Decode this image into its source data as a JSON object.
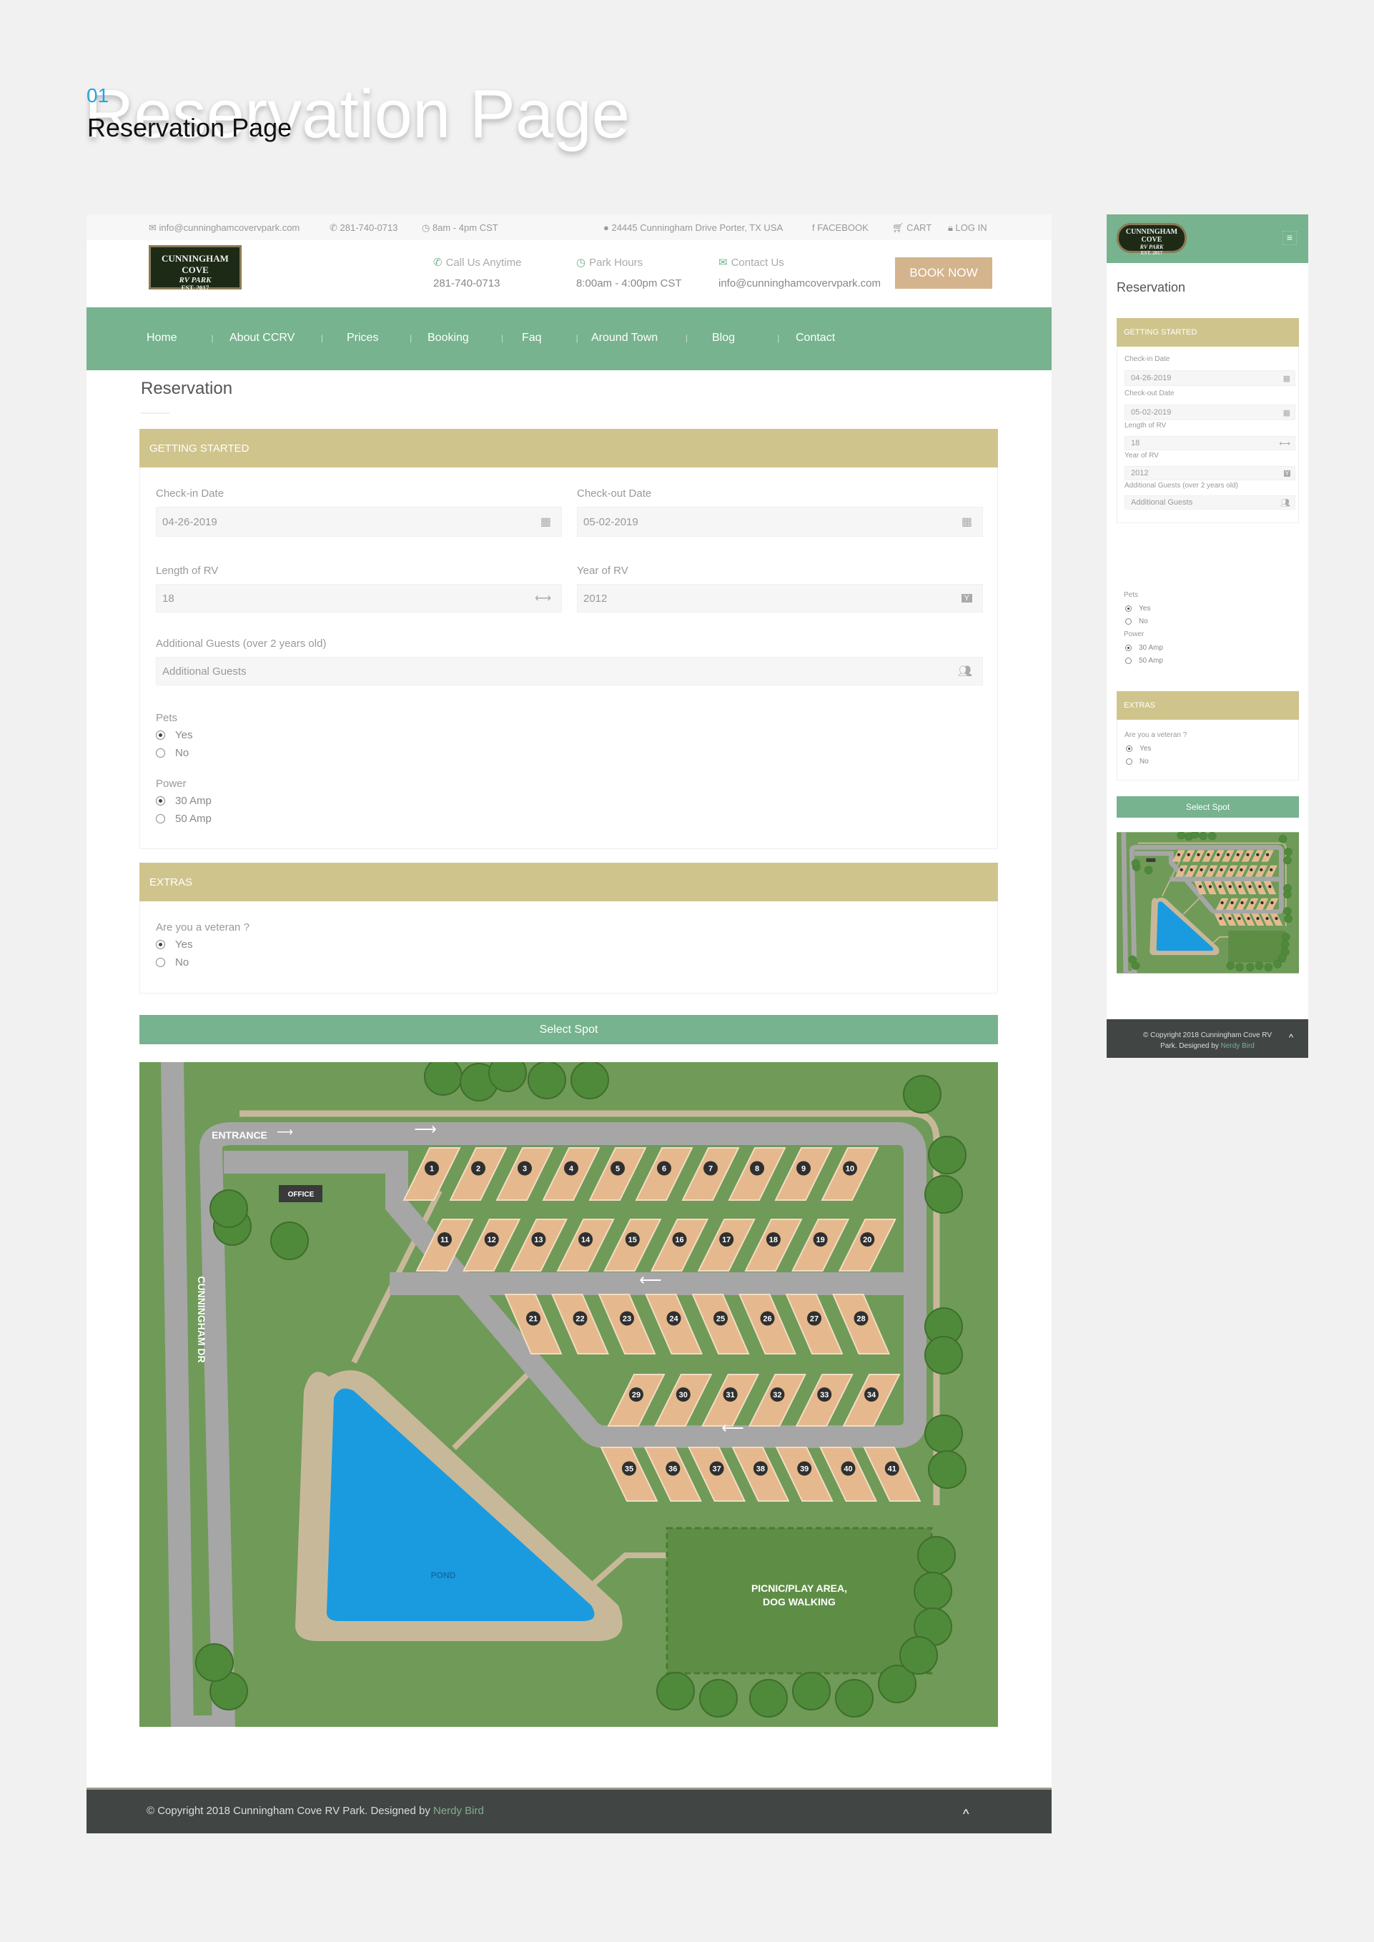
{
  "page": {
    "number": "01",
    "title": "Reservation Page"
  },
  "topbar": {
    "email": "info@cunninghamcovervpark.com",
    "phone": "281-740-0713",
    "hours": "8am - 4pm CST",
    "address": "24445 Cunningham Drive Porter, TX USA",
    "facebook": "FACEBOOK",
    "cart": "CART",
    "login": "LOG IN"
  },
  "logo": {
    "line1": "CUNNINGHAM COVE",
    "line2": "RV PARK",
    "line3": "EST. 2017"
  },
  "header": {
    "call_title": "Call Us Anytime",
    "call_value": "281-740-0713",
    "hours_title": "Park Hours",
    "hours_value": "8:00am - 4:00pm CST",
    "contact_title": "Contact Us",
    "contact_value": "info@cunninghamcovervpark.com",
    "book": "BOOK NOW"
  },
  "nav": [
    "Home",
    "About CCRV",
    "Prices",
    "Booking",
    "Faq",
    "Around Town",
    "Blog",
    "Contact"
  ],
  "form": {
    "title": "Reservation",
    "section1": "GETTING STARTED",
    "checkin_label": "Check-in Date",
    "checkin": "04-26-2019",
    "checkout_label": "Check-out Date",
    "checkout": "05-02-2019",
    "length_label": "Length of RV",
    "length": "18",
    "year_label": "Year of RV",
    "year": "2012",
    "guests_label": "Additional Guests (over 2 years old)",
    "guests_placeholder": "Additional Guests",
    "pets_label": "Pets",
    "pets_options": [
      "Yes",
      "No"
    ],
    "pets_selected": "Yes",
    "power_label": "Power",
    "power_options": [
      "30 Amp",
      "50 Amp"
    ],
    "power_selected": "30 Amp",
    "section2": "EXTRAS",
    "veteran_label": "Are you a veteran ?",
    "veteran_options": [
      "Yes",
      "No"
    ],
    "veteran_selected": "Yes",
    "select_spot": "Select Spot"
  },
  "map": {
    "entrance": "ENTRANCE",
    "office": "OFFICE",
    "road": "CUNNINGHAM DR",
    "pond": "POND",
    "picnic1": "PICNIC/PLAY AREA,",
    "picnic2": "DOG WALKING",
    "spots": [
      "1",
      "2",
      "3",
      "4",
      "5",
      "6",
      "7",
      "8",
      "9",
      "10",
      "11",
      "12",
      "13",
      "14",
      "15",
      "16",
      "17",
      "18",
      "19",
      "20",
      "21",
      "22",
      "23",
      "24",
      "25",
      "26",
      "27",
      "28",
      "29",
      "30",
      "31",
      "32",
      "33",
      "34",
      "35",
      "36",
      "37",
      "38",
      "39",
      "40",
      "41"
    ]
  },
  "footer": {
    "copyright": "© Copyright 2018 Cunningham Cove RV Park. Designed by ",
    "designer": "Nerdy Bird"
  },
  "mobile": {
    "copyright1": "© Copyright 2018 Cunningham Cove RV",
    "copyright2": "Park. Designed by ",
    "designer": "Nerdy Bird"
  },
  "colors": {
    "green": "#76b38e",
    "gold": "#d0c48d",
    "book": "#d3b48d",
    "footer": "#414645"
  }
}
